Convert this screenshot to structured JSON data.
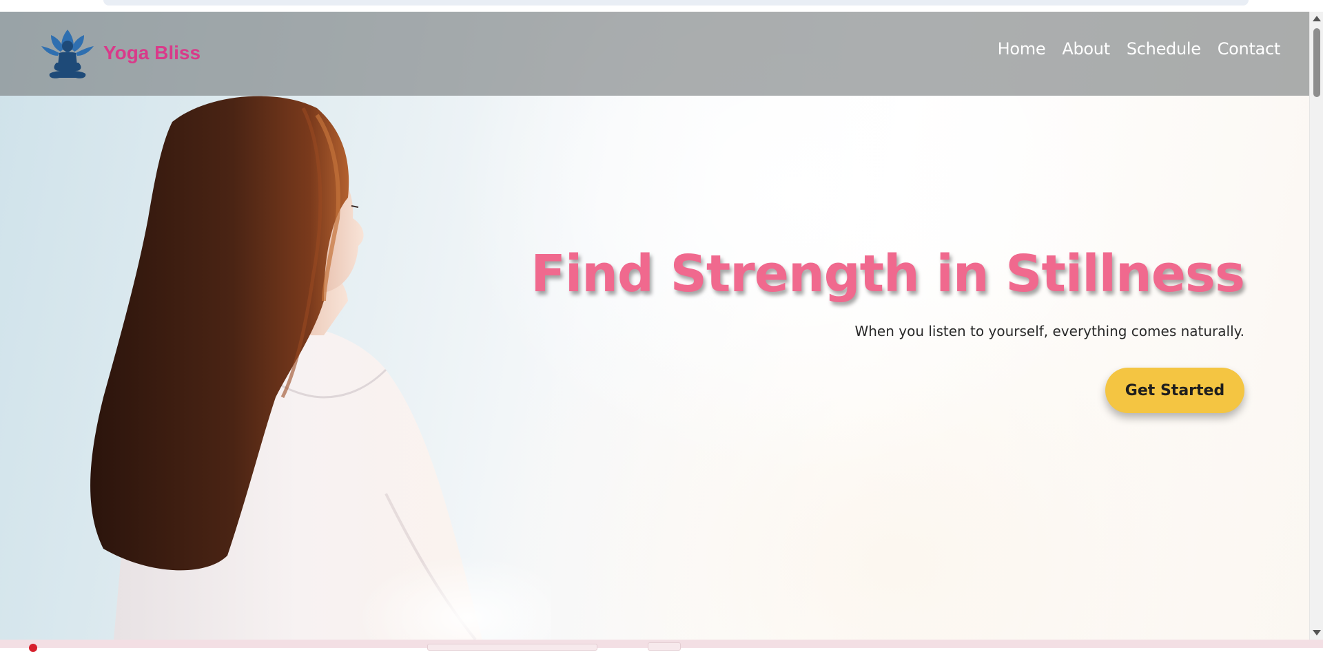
{
  "brand": {
    "name": "Yoga Bliss"
  },
  "nav": {
    "items": [
      {
        "label": "Home"
      },
      {
        "label": "About"
      },
      {
        "label": "Schedule"
      },
      {
        "label": "Contact"
      }
    ]
  },
  "hero": {
    "title": "Find Strength in Stillness",
    "subtitle": "When you listen to yourself, everything comes naturally.",
    "cta_label": "Get Started"
  },
  "colors": {
    "brand_pink": "#d93a8a",
    "title_pink": "#f0698e",
    "cta_yellow": "#f4c542",
    "logo_blue": "#2f6fb0",
    "logo_dark": "#1e4a78"
  },
  "icons": {
    "logo": "lotus-meditation-icon"
  }
}
